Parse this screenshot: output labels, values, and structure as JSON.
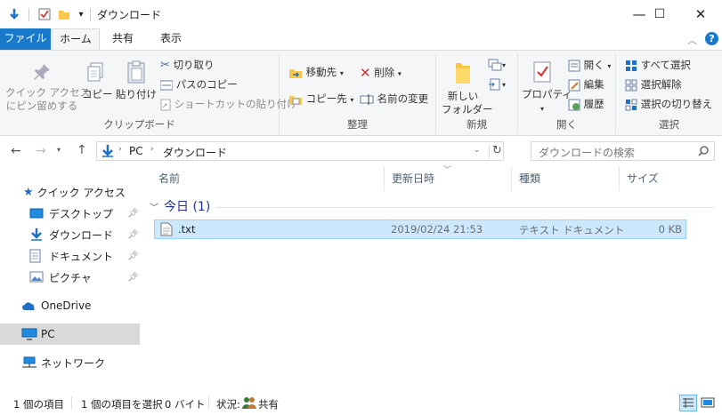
{
  "window": {
    "title": "ダウンロード",
    "minimize_glyph": "—",
    "maximize_glyph": "☐",
    "close_glyph": "✕"
  },
  "tabs": {
    "file": "ファイル",
    "home": "ホーム",
    "share": "共有",
    "view": "表示"
  },
  "ribbon": {
    "clipboard": {
      "pin_line1": "クイック アクセス",
      "pin_line2": "にピン留めする",
      "copy": "コピー",
      "paste": "貼り付け",
      "cut": "切り取り",
      "copy_path": "パスのコピー",
      "paste_shortcut": "ショートカットの貼り付け",
      "label": "クリップボード"
    },
    "organize": {
      "move_to": "移動先",
      "copy_to": "コピー先",
      "delete": "削除",
      "rename": "名前の変更",
      "label": "整理"
    },
    "new": {
      "new_folder_line1": "新しい",
      "new_folder_line2": "フォルダー",
      "label": "新規"
    },
    "open": {
      "properties": "プロパティ",
      "open": "開く",
      "edit": "編集",
      "history": "履歴",
      "label": "開く"
    },
    "select": {
      "select_all": "すべて選択",
      "select_none": "選択解除",
      "invert": "選択の切り替え",
      "label": "選択"
    }
  },
  "address": {
    "pc": "PC",
    "folder": "ダウンロード",
    "search_placeholder": "ダウンロードの検索"
  },
  "nav": {
    "quick_access": "クイック アクセス",
    "desktop": "デスクトップ",
    "downloads": "ダウンロード",
    "documents": "ドキュメント",
    "pictures": "ピクチャ",
    "onedrive": "OneDrive",
    "pc": "PC",
    "network": "ネットワーク"
  },
  "columns": {
    "name": "名前",
    "modified": "更新日時",
    "type": "種類",
    "size": "サイズ"
  },
  "group": {
    "label": "今日 (1)"
  },
  "files": [
    {
      "name": ".txt",
      "modified": "2019/02/24 21:53",
      "type": "テキスト ドキュメント",
      "size": "0 KB"
    }
  ],
  "status": {
    "items": "1 個の項目",
    "selected": "1 個の項目を選択",
    "bytes": "0 バイト",
    "state_label": "状況:",
    "state_value": "共有"
  },
  "colors": {
    "accent": "#1979ca",
    "selection": "#cce8ff",
    "folder": "#f8c84a"
  }
}
